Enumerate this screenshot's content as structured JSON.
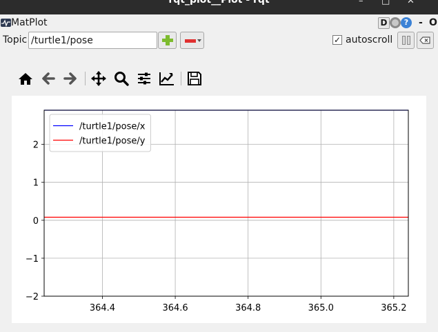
{
  "window": {
    "title": "rqt_plot__Plot - rqt",
    "controls": [
      "–",
      "□",
      "✕"
    ]
  },
  "plugin": {
    "title": "MatPlot",
    "d_label": "D",
    "help_label": "?",
    "collapse_label": "-",
    "close_label": "O"
  },
  "topic": {
    "label": "Topic",
    "value": "/turtle1/pose"
  },
  "autoscroll": {
    "label": "autoscroll",
    "checked": true,
    "check_glyph": "✓"
  },
  "toolbar": {
    "icons": [
      "home-icon",
      "back-icon",
      "forward-icon",
      "pan-icon",
      "zoom-icon",
      "configure-subplots-icon",
      "edit-axis-icon",
      "save-icon"
    ]
  },
  "chart_data": {
    "type": "line",
    "title": "",
    "xlabel": "",
    "ylabel": "",
    "xlim": [
      364.24,
      365.24
    ],
    "ylim": [
      -2.0,
      2.9
    ],
    "xticks": [
      364.4,
      364.6,
      364.8,
      365.0,
      365.2
    ],
    "xtick_labels": [
      "364.4",
      "364.6",
      "364.8",
      "365.0",
      "365.2"
    ],
    "yticks": [
      -2,
      -1,
      0,
      1,
      2
    ],
    "ytick_labels": [
      "−2",
      "−1",
      "0",
      "1",
      "2"
    ],
    "grid": true,
    "legend_position": "upper-left",
    "series": [
      {
        "name": "/turtle1/pose/x",
        "color": "#0000ff",
        "x": [
          364.24,
          365.24
        ],
        "y": [
          2.9,
          2.9
        ]
      },
      {
        "name": "/turtle1/pose/y",
        "color": "#ff0000",
        "x": [
          364.24,
          365.24
        ],
        "y": [
          0.08,
          0.08
        ]
      }
    ]
  }
}
